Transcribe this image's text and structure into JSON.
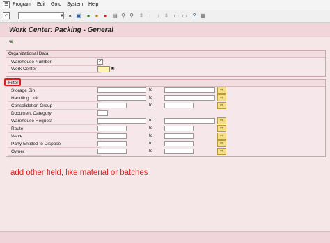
{
  "menubar": {
    "icon": "sap-menu-icon",
    "items": [
      "Program",
      "Edit",
      "Goto",
      "System",
      "Help"
    ]
  },
  "toolbar": {
    "command_value": "",
    "icons": [
      "double-left-arrow-icon",
      "save-icon",
      "back-icon",
      "exit-icon",
      "cancel-icon",
      "print-icon",
      "find-icon",
      "find-next-icon",
      "first-page-icon",
      "prev-page-icon",
      "next-page-icon",
      "last-page-icon",
      "new-session-icon",
      "shortcut-icon",
      "help-icon",
      "customize-icon"
    ]
  },
  "title": "Work Center: Packing - General",
  "app_toolbar": {
    "execute_icon": "execute-icon"
  },
  "org_data": {
    "label": "Organizational Data",
    "warehouse_number_label": "Warehouse Number",
    "work_center_label": "Work Center",
    "warehouse_number_checked": true,
    "work_center_value": ""
  },
  "filter": {
    "label": "Filter",
    "to_label": "to",
    "rows": [
      {
        "label": "Storage Bin",
        "has_to": true
      },
      {
        "label": "Handling Unit",
        "has_to": true
      },
      {
        "label": "Consolidation Group",
        "has_to": true
      },
      {
        "label": "Document Category",
        "has_to": false
      },
      {
        "label": "Warehouse Request",
        "has_to": true
      },
      {
        "label": "Route",
        "has_to": true
      },
      {
        "label": "Wave",
        "has_to": true
      },
      {
        "label": "Party Entitled to Dispose",
        "has_to": true
      },
      {
        "label": "Owner",
        "has_to": true
      }
    ]
  },
  "annotation": "add other field, like material or batches",
  "colors": {
    "background": "#f5e6e8",
    "title_bar": "#f0d5da",
    "highlight_box": "#e01b1b",
    "annotation_text": "#e02424",
    "multi_select_button": "#f2df8a"
  }
}
